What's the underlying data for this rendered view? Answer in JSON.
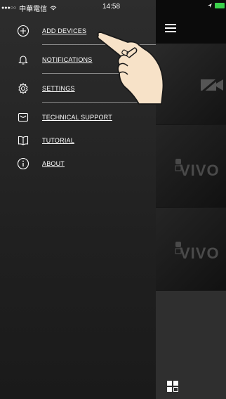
{
  "status": {
    "carrier": "中華電信",
    "time": "14:58"
  },
  "drawer": {
    "items": [
      {
        "label": "ADD DEVICES",
        "icon": "plus-circle-icon"
      },
      {
        "label": "NOTIFICATIONS",
        "icon": "bell-icon"
      },
      {
        "label": "SETTINGS",
        "icon": "gear-icon"
      },
      {
        "label": "TECHNICAL SUPPORT",
        "icon": "mail-icon"
      },
      {
        "label": "TUTORIAL",
        "icon": "book-icon"
      },
      {
        "label": "ABOUT",
        "icon": "info-icon"
      }
    ]
  },
  "main": {
    "brand_text": "VIVO",
    "colors": {
      "accent": "#3bd14b"
    }
  }
}
